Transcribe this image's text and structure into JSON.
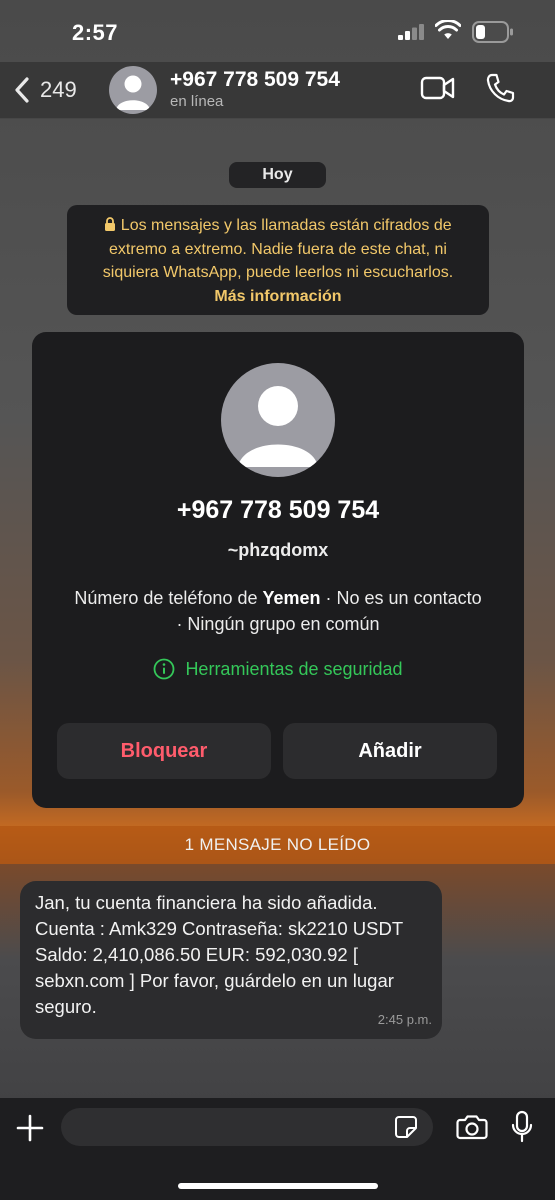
{
  "status_bar": {
    "time": "2:57"
  },
  "header": {
    "back_count": "249",
    "contact_name": "+967 778 509 754",
    "contact_status": "en línea"
  },
  "chat": {
    "date_label": "Hoy",
    "encryption_notice": "Los mensajes y las llamadas están cifrados de extremo a extremo. Nadie fuera de este chat, ni siquiera WhatsApp, puede leerlos ni escucharlos.",
    "encryption_more": "Más información"
  },
  "contact_card": {
    "phone": "+967 778 509 754",
    "username": "~phzqdomx",
    "info_prefix": "Número de teléfono de ",
    "country": "Yemen",
    "info_suffix": " · No es un contacto · Ningún grupo en común",
    "security_tools": "Herramientas de seguridad",
    "block_label": "Bloquear",
    "add_label": "Añadir"
  },
  "unread_banner": "1 MENSAJE NO LEÍDO",
  "message": {
    "text": "Jan, tu cuenta financiera ha sido añadida. Cuenta : Amk329 Contraseña: sk2210 USDT Saldo: 2,410,086.50 EUR: 592,030.92 [ sebxn.com ] Por favor, guárdelo en un lugar seguro.",
    "time": "2:45 p.m."
  },
  "composer": {
    "placeholder": ""
  },
  "colors": {
    "accent_green": "#34c759",
    "danger_red": "#ff5c6c",
    "notice_yellow": "#f2c86a",
    "unread_orange": "#b45814"
  },
  "icons": [
    "back-chevron",
    "video-camera",
    "phone",
    "lock",
    "info-circle",
    "plus",
    "sticker",
    "camera",
    "microphone"
  ]
}
